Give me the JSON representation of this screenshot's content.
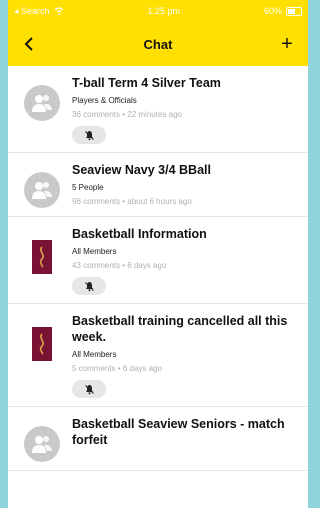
{
  "status_bar": {
    "carrier": "◂ Search",
    "time": "1:25 pm",
    "battery": "60%"
  },
  "nav": {
    "title": "Chat",
    "add_label": "+"
  },
  "chats": [
    {
      "title": "T-ball Term 4 Silver Team",
      "audience": "Players & Officials",
      "meta": "36 comments • 22 minutes ago",
      "avatar": "person-icon",
      "muted": true
    },
    {
      "title": "Seaview Navy 3/4 BBall",
      "audience": "5 People",
      "meta": "96 comments • about 6 hours ago",
      "avatar": "person-icon",
      "muted": false
    },
    {
      "title": "Basketball Information",
      "audience": "All Members",
      "meta": "43 comments • 6 days ago",
      "avatar": "club-logo",
      "muted": true
    },
    {
      "title": "Basketball training cancelled all this week.",
      "audience": "All Members",
      "meta": "5 comments • 6 days ago",
      "avatar": "club-logo",
      "muted": true
    },
    {
      "title": "Basketball Seaview Seniors - match forfeit",
      "audience": "",
      "meta": "",
      "avatar": "person-icon",
      "muted": false
    }
  ],
  "colors": {
    "accent": "#ffe000",
    "background": "#8fd3dc",
    "logo": "#7a1234"
  }
}
